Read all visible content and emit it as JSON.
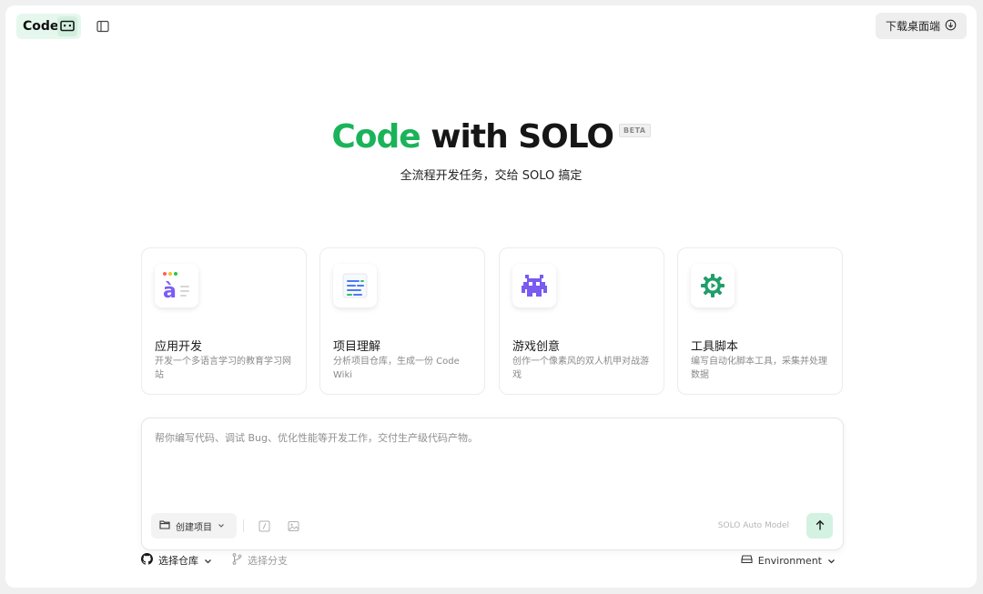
{
  "header": {
    "mode_label": "Code",
    "download_label": "下载桌面端"
  },
  "hero": {
    "title_green": "Code",
    "title_rest": "with SOLO",
    "badge": "BETA",
    "subtitle": "全流程开发任务，交给 SOLO 搞定"
  },
  "cards": [
    {
      "title": "应用开发",
      "desc": "开发一个多语言学习的教育学习网站",
      "icon": "app-dev-icon"
    },
    {
      "title": "项目理解",
      "desc": "分析项目仓库，生成一份 Code Wiki",
      "icon": "project-doc-icon"
    },
    {
      "title": "游戏创意",
      "desc": "创作一个像素风的双人机甲对战游戏",
      "icon": "pixel-game-icon"
    },
    {
      "title": "工具脚本",
      "desc": "编写自动化脚本工具，采集并处理数据",
      "icon": "gear-play-icon"
    }
  ],
  "composer": {
    "placeholder": "帮你编写代码、调试 Bug、优化性能等开发工作，交付生产级代码产物。",
    "project_button": "创建项目",
    "model_label": "SOLO Auto Model"
  },
  "footer": {
    "repo_label": "选择仓库",
    "branch_label": "选择分支",
    "environment_label": "Environment"
  },
  "colors": {
    "accent": "#1bb35a",
    "accent_light": "#e6f7ee",
    "send_bg": "#d4f2e1"
  }
}
